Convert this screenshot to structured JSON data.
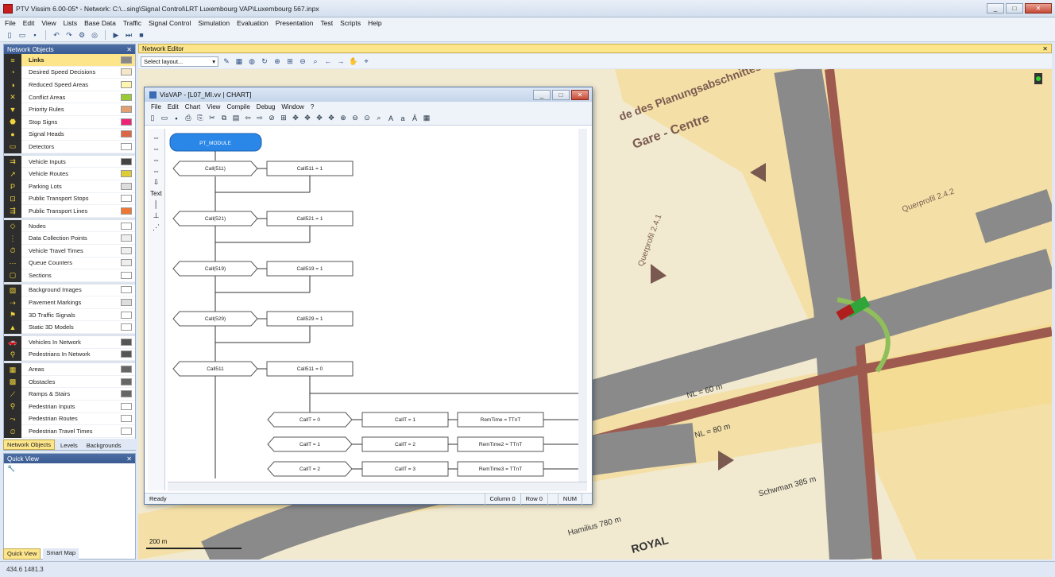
{
  "app": {
    "title": "PTV Vissim 6.00-05* - Network: C:\\...sing\\Signal Control\\LRT Luxembourg VAP\\Luxembourg 567.inpx",
    "status": "434.6 1481.3"
  },
  "menu": [
    "File",
    "Edit",
    "View",
    "Lists",
    "Base Data",
    "Traffic",
    "Signal Control",
    "Simulation",
    "Evaluation",
    "Presentation",
    "Test",
    "Scripts",
    "Help"
  ],
  "network_objects": {
    "title": "Network Objects",
    "groups": [
      [
        {
          "label": "Links",
          "icon": "links-icon",
          "active": true,
          "swatch": "#888"
        },
        {
          "label": "Desired Speed Decisions",
          "icon": "speed-icon",
          "swatch": "#f3e7c8"
        },
        {
          "label": "Reduced Speed Areas",
          "icon": "reduced-speed-icon",
          "swatch": "#fdf5b0"
        },
        {
          "label": "Conflict Areas",
          "icon": "conflict-icon",
          "swatch": "#9c3"
        },
        {
          "label": "Priority Rules",
          "icon": "priority-icon",
          "swatch": "#e0a070"
        },
        {
          "label": "Stop Signs",
          "icon": "stop-icon",
          "swatch": "#e27"
        },
        {
          "label": "Signal Heads",
          "icon": "signal-icon",
          "swatch": "#d64"
        },
        {
          "label": "Detectors",
          "icon": "detector-icon",
          "swatch": "#fff"
        }
      ],
      [
        {
          "label": "Vehicle Inputs",
          "icon": "vehicle-input-icon",
          "swatch": "#444"
        },
        {
          "label": "Vehicle Routes",
          "icon": "route-icon",
          "swatch": "#dc3"
        },
        {
          "label": "Parking Lots",
          "icon": "parking-icon",
          "swatch": "#ddd"
        },
        {
          "label": "Public Transport Stops",
          "icon": "pt-stop-icon",
          "swatch": "#fff"
        },
        {
          "label": "Public Transport Lines",
          "icon": "pt-line-icon",
          "swatch": "#e73"
        }
      ],
      [
        {
          "label": "Nodes",
          "icon": "node-icon",
          "swatch": "#fff"
        },
        {
          "label": "Data Collection Points",
          "icon": "dcp-icon",
          "swatch": "#eee"
        },
        {
          "label": "Vehicle Travel Times",
          "icon": "travel-time-icon",
          "swatch": "#eee"
        },
        {
          "label": "Queue Counters",
          "icon": "queue-icon",
          "swatch": "#eee"
        },
        {
          "label": "Sections",
          "icon": "section-icon",
          "swatch": "#fff"
        }
      ],
      [
        {
          "label": "Background Images",
          "icon": "bg-image-icon",
          "swatch": "#fff"
        },
        {
          "label": "Pavement Markings",
          "icon": "marking-icon",
          "swatch": "#ddd"
        },
        {
          "label": "3D Traffic Signals",
          "icon": "signal3d-icon",
          "swatch": "#fff"
        },
        {
          "label": "Static 3D Models",
          "icon": "model3d-icon",
          "swatch": "#fff"
        }
      ],
      [
        {
          "label": "Vehicles In Network",
          "icon": "vehicles-icon",
          "swatch": "#555"
        },
        {
          "label": "Pedestrians In Network",
          "icon": "pedestrians-icon",
          "swatch": "#555"
        }
      ],
      [
        {
          "label": "Areas",
          "icon": "area-icon",
          "swatch": "#666"
        },
        {
          "label": "Obstacles",
          "icon": "obstacle-icon",
          "swatch": "#666"
        },
        {
          "label": "Ramps & Stairs",
          "icon": "ramp-icon",
          "swatch": "#666"
        },
        {
          "label": "Pedestrian Inputs",
          "icon": "ped-input-icon",
          "swatch": "#fff"
        },
        {
          "label": "Pedestrian Routes",
          "icon": "ped-route-icon",
          "swatch": "#fff"
        },
        {
          "label": "Pedestrian Travel Times",
          "icon": "ped-time-icon",
          "swatch": "#fff"
        }
      ]
    ]
  },
  "left_tabs": [
    "Network Objects",
    "Levels",
    "Backgrounds"
  ],
  "quick_view": {
    "title": "Quick View",
    "tabs": [
      "Quick View",
      "Smart Map"
    ]
  },
  "editor": {
    "title": "Network Editor",
    "layout_placeholder": "Select layout..."
  },
  "vis": {
    "title": "VisVAP - [L07_MI.vv | CHART]",
    "menu": [
      "File",
      "Edit",
      "Chart",
      "View",
      "Compile",
      "Debug",
      "Window",
      "?"
    ],
    "status": [
      "Ready",
      "Column 0",
      "Row 0",
      "",
      "NUM",
      ""
    ]
  },
  "map_labels": {
    "gare": "Gare - Centre",
    "plan": "de des Planungsabschnittes",
    "quer1": "Querprofil 2.4.2",
    "quer2": "Querprofil 2.4.1",
    "royal": "ROYAL",
    "nl1": "NL = 60 m",
    "nl2": "NL = 80 m",
    "sch": "Schwman 385 m",
    "ham": "Hamilius 780 m",
    "scale": "200 m"
  },
  "flowchart": {
    "start": "PT_MODULE",
    "rows": [
      [
        "Call(511)",
        "Call511 = 1"
      ],
      [
        "Call(521)",
        "Call521 = 1"
      ],
      [
        "Call(519)",
        "Call519 = 1"
      ],
      [
        "Call(529)",
        "Call529 = 1"
      ],
      [
        "Call511",
        "Call511 = 0"
      ]
    ],
    "sub": [
      [
        "CallT = 0",
        "CallT = 1",
        "RemTime = TTnT"
      ],
      [
        "CallT = 1",
        "CallT = 2",
        "RemTime2 = TTnT"
      ],
      [
        "CallT = 2",
        "CallT = 3",
        "RemTime3 = TTnT"
      ]
    ]
  }
}
